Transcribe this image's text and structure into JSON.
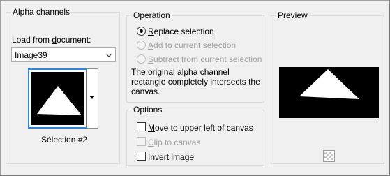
{
  "alpha": {
    "title": "Alpha channels",
    "load_label_pre": "Load from ",
    "load_label_u": "d",
    "load_label_post": "ocument:",
    "document_value": "Image39",
    "selection_name": "Sélection #2"
  },
  "operation": {
    "title": "Operation",
    "replace": {
      "pre": "",
      "u": "R",
      "post": "eplace selection",
      "checked": true,
      "enabled": true
    },
    "add": {
      "pre": "",
      "u": "A",
      "post": "dd to current selection",
      "checked": false,
      "enabled": false
    },
    "subtract": {
      "pre": "",
      "u": "S",
      "post": "ubtract from current selection",
      "checked": false,
      "enabled": false
    },
    "message_1": "The original alpha channel",
    "message_2": "rectangle completely intersects the",
    "message_3": "canvas."
  },
  "options": {
    "title": "Options",
    "move": {
      "pre": "",
      "u": "M",
      "post": "ove to upper left of canvas",
      "checked": false,
      "enabled": true
    },
    "clip": {
      "pre": "",
      "u": "C",
      "post": "lip to canvas",
      "checked": false,
      "enabled": false
    },
    "invert": {
      "pre": "",
      "u": "I",
      "post": "nvert image",
      "checked": false,
      "enabled": true
    }
  },
  "preview": {
    "title": "Preview",
    "checker_icon": "transparency-checker-icon"
  },
  "colors": {
    "selection_border": "#2b86d9",
    "disabled_text": "#a0a0a0"
  }
}
